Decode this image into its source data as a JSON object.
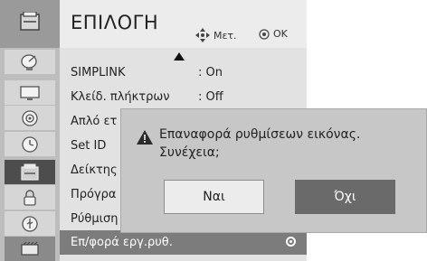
{
  "header": {
    "title": "ΕΠΙΛΟΓΗ",
    "move_hint": "Μετ.",
    "ok_hint": "OK"
  },
  "sidebar": {
    "items": [
      {
        "icon": "satellite-dish-icon"
      },
      {
        "icon": "tv-screen-icon"
      },
      {
        "icon": "speaker-icon"
      },
      {
        "icon": "clock-icon"
      },
      {
        "icon": "option-box-icon",
        "selected": true
      },
      {
        "icon": "lock-icon"
      },
      {
        "icon": "usb-icon"
      },
      {
        "icon": "film-icon"
      }
    ]
  },
  "menu": {
    "rows": [
      {
        "label": "SIMPLINK",
        "value": ": On"
      },
      {
        "label": "Κλείδ. πλήκτρων",
        "value": ": Off"
      },
      {
        "label": "Απλό ετ",
        "value": ""
      },
      {
        "label": "Set ID",
        "value": ""
      },
      {
        "label": "Δείκτης",
        "value": ""
      },
      {
        "label": "Πρόγρα",
        "value": ""
      },
      {
        "label": "Ρύθμιση",
        "value": ""
      },
      {
        "label": "Επ/φορά εργ.ρυθ.",
        "value": "",
        "selected": true
      }
    ]
  },
  "dialog": {
    "line1": "Επαναφορά ρυθμίσεων εικόνας.",
    "line2": "Συνέχεια;",
    "yes_label": "Ναι",
    "no_label": "Όχι"
  },
  "colors": {
    "selected_row": "#7c7c7c",
    "selected_button": "#6a6a6a",
    "dialog_bg": "#c7c7c7",
    "warning": "#2b2b2b"
  }
}
